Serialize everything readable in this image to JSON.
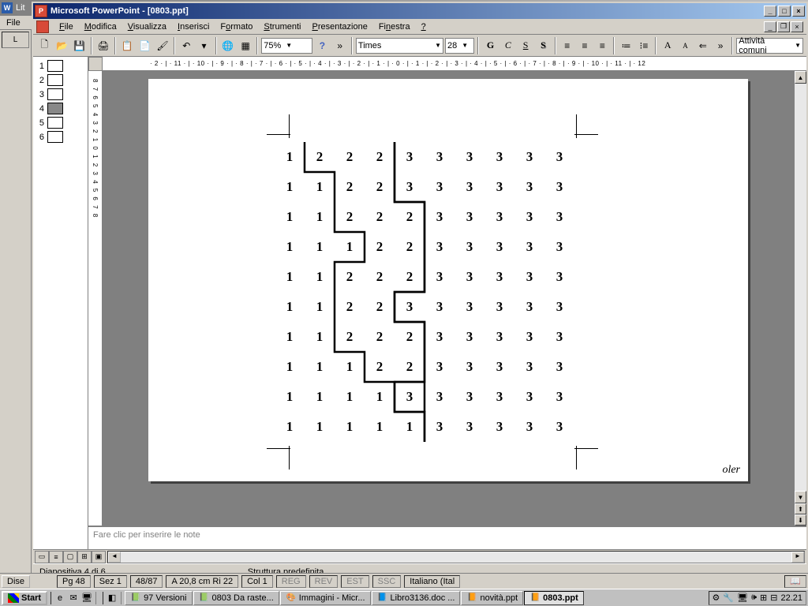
{
  "bgapp": {
    "title": "Lit",
    "menu_file": "File"
  },
  "ppt": {
    "title": "Microsoft PowerPoint - [0803.ppt]",
    "menu": [
      "File",
      "Modifica",
      "Visualizza",
      "Inserisci",
      "Formato",
      "Strumenti",
      "Presentazione",
      "Finestra",
      "?"
    ],
    "zoom": "75%",
    "font": "Times",
    "fontsize": "28",
    "attivita": "Attività comuni",
    "hruler": "· 2 · | · 11 · | · 10 · | · 9 · | · 8 · | · 7 · | · 6 · | · 5 · | · 4 · | · 3 · | · 2 · | · 1 · | · 0 · | · 1 · | · 2 · | · 3 · | · 4 · | · 5 · | · 6 · | · 7 · | · 8 · | · 9 · | · 10 · | · 11 · | · 12",
    "vruler": "8 7 6 5 4 3 2 1 0 1 2 3 4 5 6 7 8",
    "thumbs": [
      1,
      2,
      3,
      4,
      5,
      6
    ],
    "thumb_selected": 4,
    "notes_placeholder": "Fare clic per inserire le note",
    "status_slide": "Diapositiva 4 di 6",
    "status_layout": "Struttura predefinita",
    "signature": "oler"
  },
  "grid": [
    [
      1,
      2,
      2,
      2,
      3,
      3,
      3,
      3,
      3,
      3
    ],
    [
      1,
      1,
      2,
      2,
      3,
      3,
      3,
      3,
      3,
      3
    ],
    [
      1,
      1,
      2,
      2,
      2,
      3,
      3,
      3,
      3,
      3
    ],
    [
      1,
      1,
      1,
      2,
      2,
      3,
      3,
      3,
      3,
      3
    ],
    [
      1,
      1,
      2,
      2,
      2,
      3,
      3,
      3,
      3,
      3
    ],
    [
      1,
      1,
      2,
      2,
      3,
      3,
      3,
      3,
      3,
      3
    ],
    [
      1,
      1,
      2,
      2,
      2,
      3,
      3,
      3,
      3,
      3
    ],
    [
      1,
      1,
      1,
      2,
      2,
      3,
      3,
      3,
      3,
      3
    ],
    [
      1,
      1,
      1,
      1,
      3,
      3,
      3,
      3,
      3,
      3
    ],
    [
      1,
      1,
      1,
      1,
      1,
      3,
      3,
      3,
      3,
      3
    ]
  ],
  "word_status": {
    "dise": "Dise",
    "pg": "Pg  48",
    "sez": "Sez  1",
    "pages": "48/87",
    "pos": "A  20,8 cm   Ri  22",
    "col": "Col  1",
    "reg": "REG",
    "rev": "REV",
    "est": "EST",
    "ssc": "SSC",
    "lang": "Italiano (Ital"
  },
  "taskbar": {
    "start": "Start",
    "items": [
      {
        "icon": "📗",
        "label": "97 Versioni"
      },
      {
        "icon": "📗",
        "label": "0803 Da raste..."
      },
      {
        "icon": "🎨",
        "label": "Immagini - Micr..."
      },
      {
        "icon": "📘",
        "label": "Libro3136.doc ..."
      },
      {
        "icon": "📙",
        "label": "novità.ppt"
      },
      {
        "icon": "📙",
        "label": "0803.ppt",
        "active": true
      }
    ],
    "clock": "22.21"
  }
}
